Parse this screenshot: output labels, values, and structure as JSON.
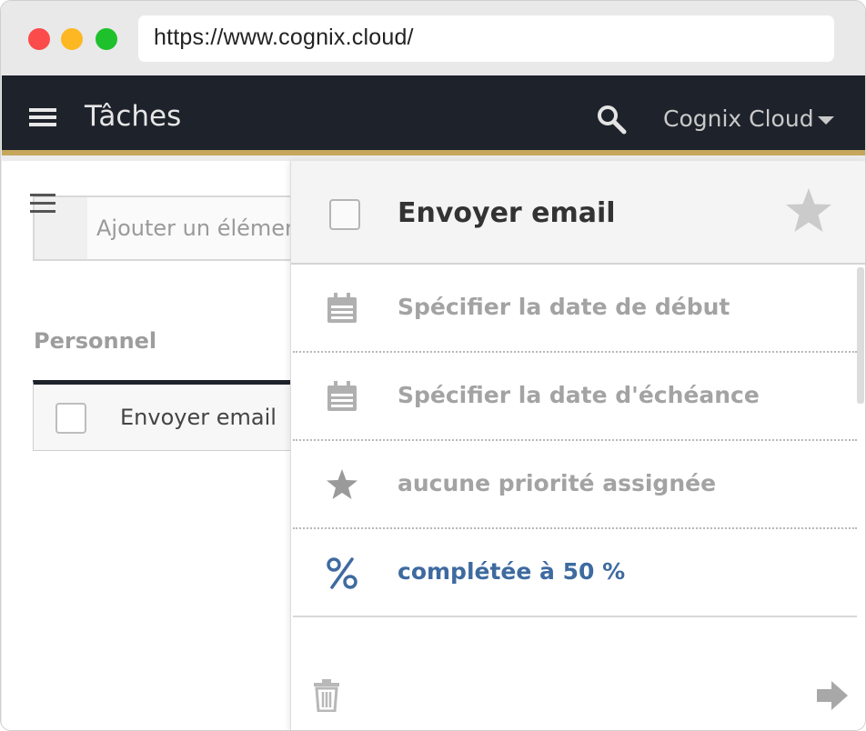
{
  "browser": {
    "url": "https://www.cognix.cloud/"
  },
  "header": {
    "title": "Tâches",
    "account_name": "Cognix Cloud"
  },
  "list": {
    "add_placeholder": "Ajouter un élément",
    "heading": "Personnel",
    "tasks": [
      {
        "label": "Envoyer email"
      }
    ]
  },
  "detail": {
    "title": "Envoyer email",
    "fields": [
      {
        "icon": "calendar-icon",
        "label": "Spécifier la date de début"
      },
      {
        "icon": "calendar-icon",
        "label": "Spécifier la date d'échéance"
      },
      {
        "icon": "star-icon",
        "label": "aucune priorité assignée"
      },
      {
        "icon": "percent-icon",
        "label": "complétée à 50 %",
        "percent_complete": 50
      }
    ]
  },
  "colors": {
    "header_bg": "#1e222b",
    "accent_gold": "#c5a65b",
    "progress_blue": "#3e6aa0",
    "muted_text": "#a3a3a3"
  }
}
